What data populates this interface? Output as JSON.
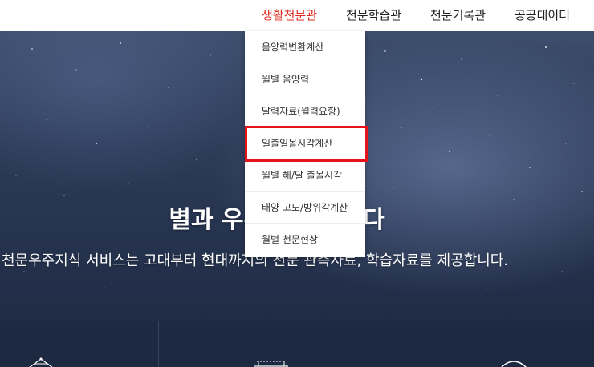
{
  "nav": {
    "items": [
      {
        "label": "생활천문관",
        "active": true
      },
      {
        "label": "천문학습관",
        "active": false
      },
      {
        "label": "천문기록관",
        "active": false
      },
      {
        "label": "공공데이터",
        "active": false
      }
    ]
  },
  "dropdown": {
    "items": [
      {
        "label": "음양력변환계산"
      },
      {
        "label": "월별 음양력"
      },
      {
        "label": "달력자료(월력요항)"
      },
      {
        "label": "일출일몰시각계산"
      },
      {
        "label": "월별 해/달 출몰시각"
      },
      {
        "label": "태양 고도/방위각계산"
      },
      {
        "label": "월별 천문현상"
      }
    ],
    "highlighted_index": 3
  },
  "hero": {
    "title": "별과 우주를 탐구하다",
    "subtitle": "천문우주지식 서비스는 고대부터 현대까지의 천문 관측자료, 학습자료를 제공합니다."
  },
  "colors": {
    "accent": "#e0281e",
    "highlight_border": "#e8121b",
    "hero_dark": "#25324d",
    "band": "#1c2941"
  }
}
